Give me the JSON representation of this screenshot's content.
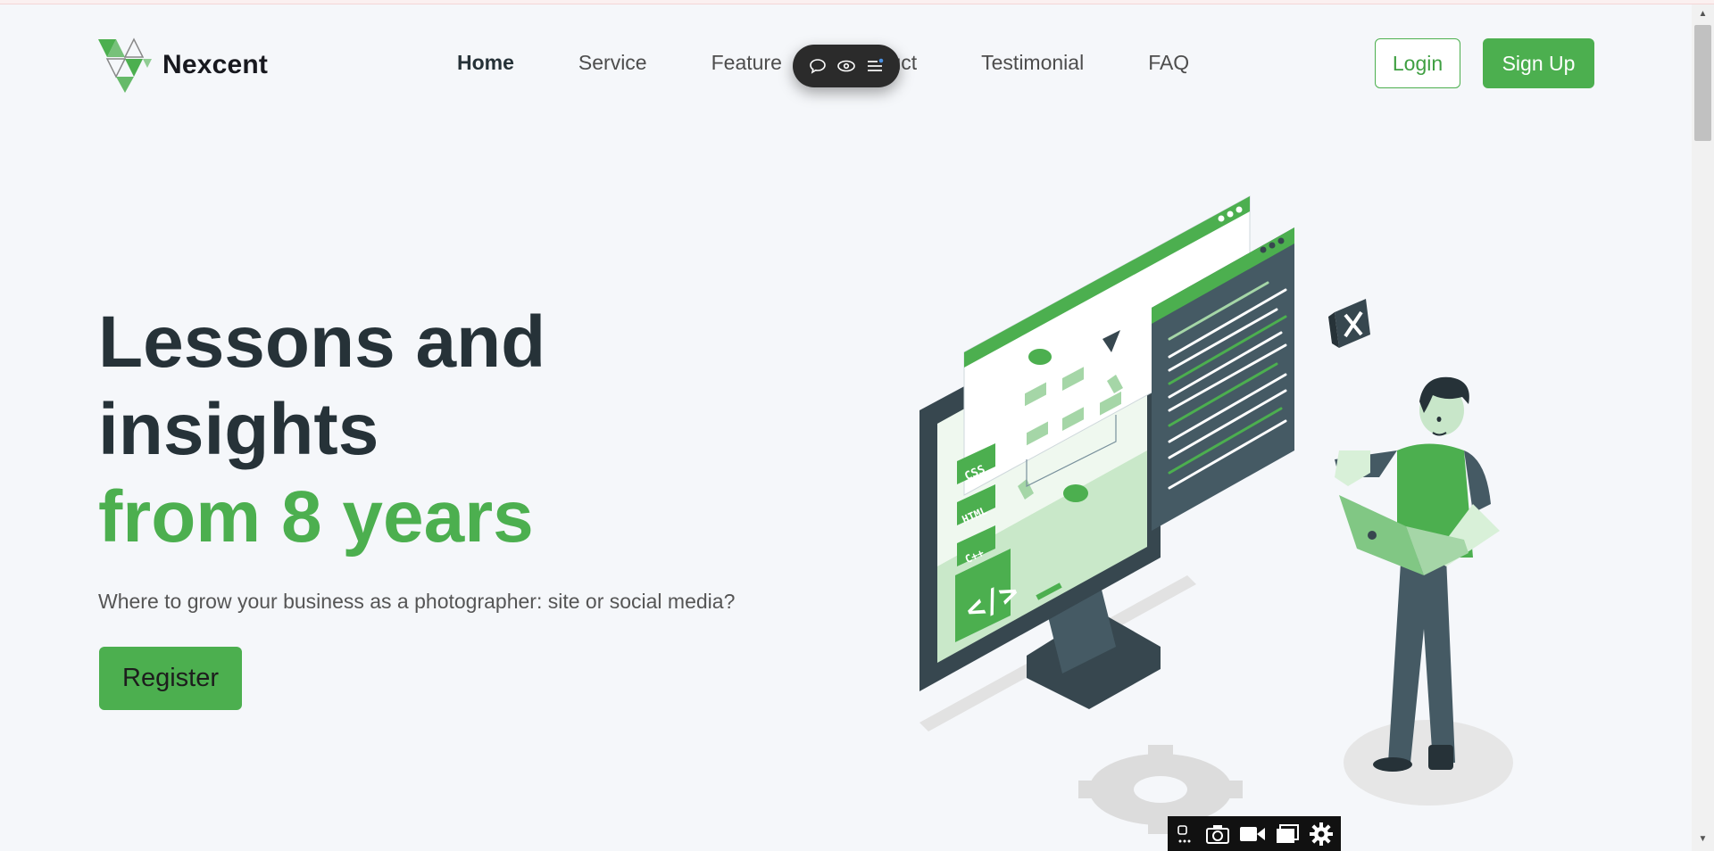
{
  "brand": {
    "name": "Nexcent",
    "logo_icon": "nexcent-logo-icon"
  },
  "nav": {
    "items": [
      {
        "label": "Home",
        "active": true
      },
      {
        "label": "Service",
        "active": false
      },
      {
        "label": "Feature",
        "active": false
      },
      {
        "label": "Product",
        "active": false
      },
      {
        "label": "Testimonial",
        "active": false
      },
      {
        "label": "FAQ",
        "active": false
      }
    ]
  },
  "auth": {
    "login_label": "Login",
    "signup_label": "Sign Up"
  },
  "hero": {
    "title_line1": "Lessons and",
    "title_line2": "insights",
    "title_accent": "from 8 years",
    "subtitle": "Where to grow your business as a photographer: site or social media?",
    "cta_label": "Register"
  },
  "illustration": {
    "code_labels": [
      "CSS",
      "HTML",
      "C++"
    ],
    "code_tag": "</>"
  },
  "floating_toolbar": {
    "icons": [
      "comment-icon",
      "eye-icon",
      "menu-icon"
    ]
  },
  "capture_toolbar": {
    "icons": [
      "extension-icon",
      "camera-icon",
      "video-icon",
      "window-icon",
      "settings-gear-icon"
    ]
  },
  "colors": {
    "accent": "#4caf4f",
    "dark": "#263238",
    "background": "#f5f7fa",
    "slate": "#455a64"
  }
}
